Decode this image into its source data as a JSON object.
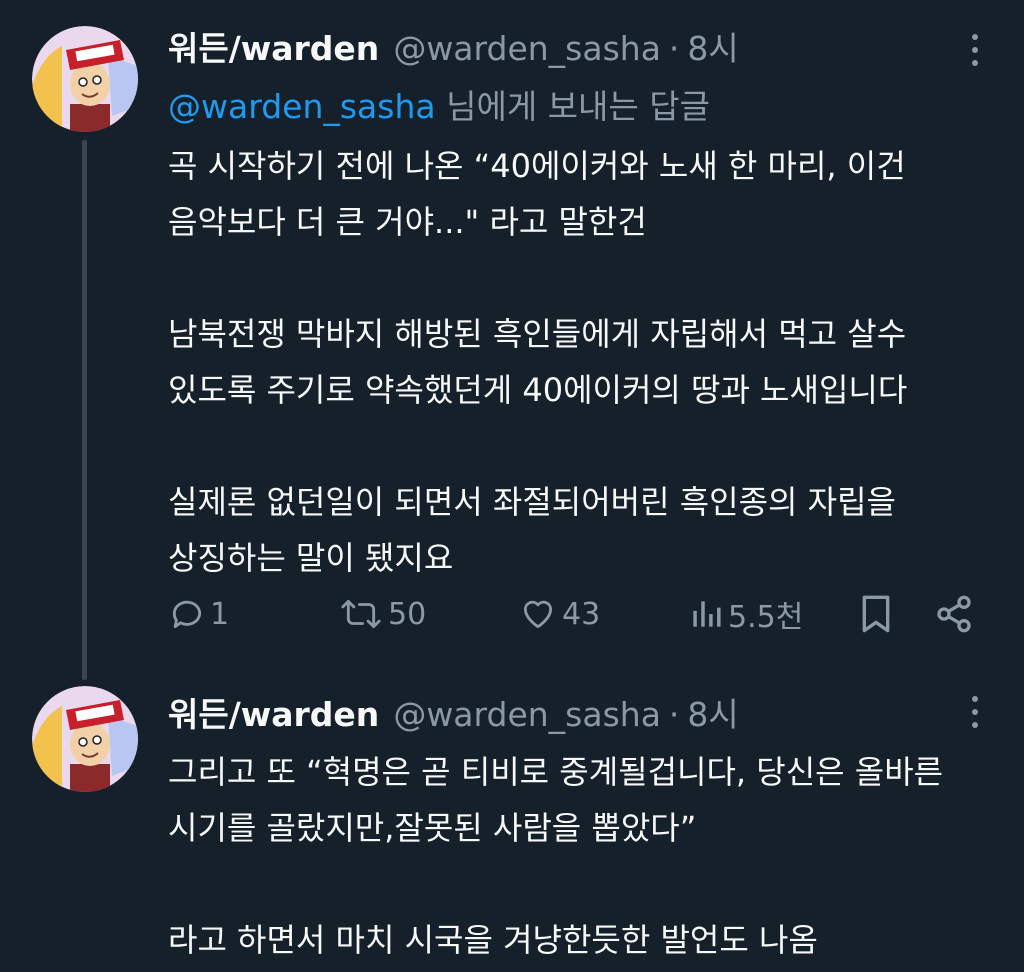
{
  "tweets": [
    {
      "name": "워든/warden",
      "handle": "@warden_sasha",
      "separator": "·",
      "time": "8시",
      "reply_to_mention": "@warden_sasha",
      "reply_to_suffix": " 님에게 보내는 답글",
      "paragraphs": [
        [
          "곡 시작하기 전에 나온 “40에이커와 노새 한 마리, 이건",
          "음악보다 더 큰 거야...\" 라고 말한건"
        ],
        [
          "남북전쟁 막바지 해방된 흑인들에게 자립해서 먹고 살수",
          "있도록 주기로 약속했던게 40에이커의 땅과 노새입니다"
        ],
        [
          "실제론 없던일이 되면서 좌절되어버린 흑인종의 자립을",
          "상징하는 말이 됐지요"
        ]
      ],
      "actions": {
        "replies": "1",
        "retweets": "50",
        "likes": "43",
        "views": "5.5천"
      },
      "icons": {
        "reply": "reply-icon",
        "retweet": "retweet-icon",
        "like": "heart-icon",
        "views": "views-icon",
        "bookmark": "bookmark-icon",
        "share": "share-icon",
        "more": "more-icon"
      }
    },
    {
      "name": "워든/warden",
      "handle": "@warden_sasha",
      "separator": "·",
      "time": "8시",
      "paragraphs": [
        [
          "그리고 또 “혁명은 곧 티비로 중계될겁니다, 당신은 올바른",
          "시기를 골랐지만,잘못된 사람을 뽑았다”"
        ],
        [
          "라고 하면서 마치 시국을 겨냥한듯한 발언도 나옴"
        ]
      ]
    }
  ],
  "colors": {
    "background": "#15202b",
    "text": "#f7f9f9",
    "secondary": "#8b98a5",
    "accent": "#1d9bf0"
  }
}
